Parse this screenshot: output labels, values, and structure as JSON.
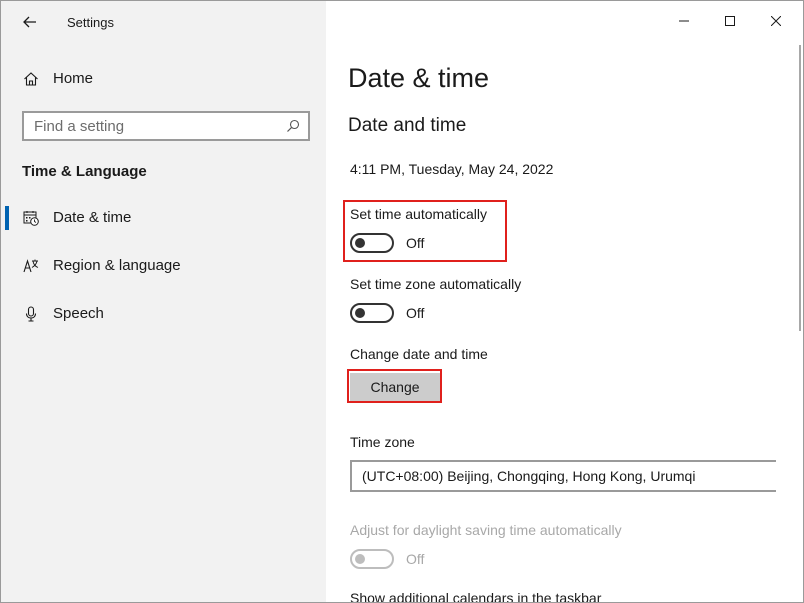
{
  "window": {
    "title": "Settings",
    "controls": {
      "minimize": "minimize",
      "maximize": "maximize",
      "close": "close"
    }
  },
  "sidebar": {
    "home_label": "Home",
    "search_placeholder": "Find a setting",
    "section_title": "Time & Language",
    "items": [
      {
        "label": "Date & time",
        "icon": "calendar-clock-icon",
        "active": true
      },
      {
        "label": "Region & language",
        "icon": "language-icon",
        "active": false
      },
      {
        "label": "Speech",
        "icon": "microphone-icon",
        "active": false
      }
    ]
  },
  "main": {
    "page_title": "Date & time",
    "section_title": "Date and time",
    "current_datetime": "4:11 PM, Tuesday, May 24, 2022",
    "set_time_auto": {
      "label": "Set time automatically",
      "state": "Off"
    },
    "set_timezone_auto": {
      "label": "Set time zone automatically",
      "state": "Off"
    },
    "change_date_time": {
      "label": "Change date and time",
      "button": "Change"
    },
    "time_zone": {
      "label": "Time zone",
      "value": "(UTC+08:00) Beijing, Chongqing, Hong Kong, Urumqi"
    },
    "daylight_saving": {
      "label": "Adjust for daylight saving time automatically",
      "state": "Off"
    },
    "additional_calendars_label": "Show additional calendars in the taskbar"
  },
  "colors": {
    "accent": "#0063b1",
    "highlight": "#e0201c",
    "sidebar_bg": "#f2f2f2",
    "button_bg": "#cccccc"
  }
}
